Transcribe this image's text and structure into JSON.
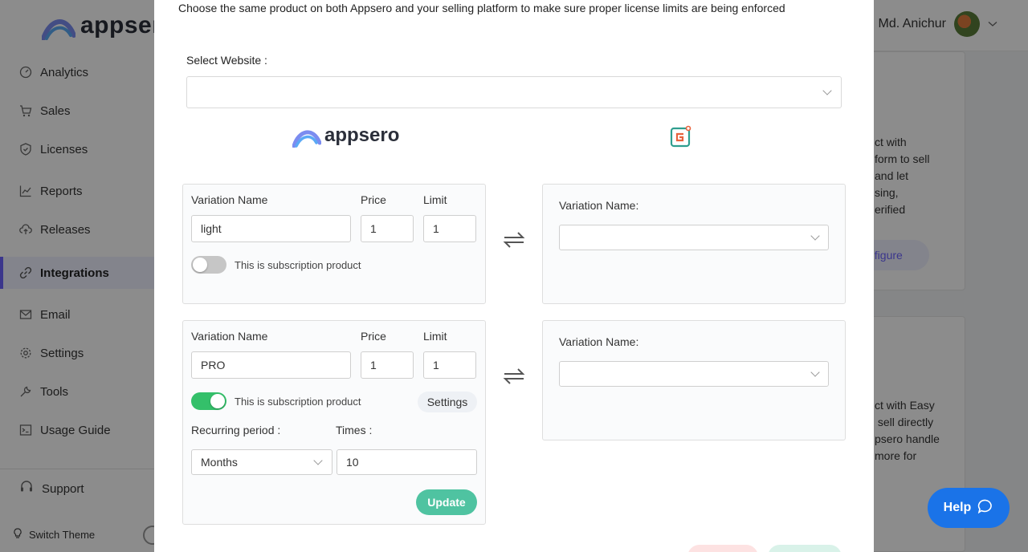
{
  "brand": {
    "name": "appsero"
  },
  "sidebar": {
    "items": [
      {
        "label": "Analytics",
        "icon": "gauge-icon"
      },
      {
        "label": "Sales",
        "icon": "cart-icon"
      },
      {
        "label": "Licenses",
        "icon": "shield-icon"
      },
      {
        "label": "Reports",
        "icon": "chart-icon"
      },
      {
        "label": "Releases",
        "icon": "cloud-upload-icon"
      },
      {
        "label": "Integrations",
        "icon": "link-icon",
        "active": true
      },
      {
        "label": "Email",
        "icon": "envelope-icon"
      },
      {
        "label": "Settings",
        "icon": "gear-icon"
      },
      {
        "label": "Tools",
        "icon": "wrench-icon"
      },
      {
        "label": "Usage Guide",
        "icon": "terminal-icon"
      }
    ],
    "support_label": "Support",
    "switch_theme_label": "Switch Theme"
  },
  "header": {
    "user_name": "Md. Anichur"
  },
  "cards": {
    "card1_text": "ct with\nform to sell\nand let\nsing,\nerified",
    "card1_button": "nfigure",
    "card2_text": "ct with Easy\n sell directly\npsero handle\nmore for"
  },
  "modal": {
    "intro": "Choose the same product on both Appsero and your selling platform to make sure proper license limits are being enforced",
    "select_website_label": "Select Website :",
    "select_website_value": "",
    "variation_name_label": "Variation Name",
    "price_label": "Price",
    "limit_label": "Limit",
    "subscription_label": "This is subscription product",
    "platform_variation_label": "Variation Name:",
    "variations": [
      {
        "name": "light",
        "price": "1",
        "limit": "1",
        "subscription": false
      },
      {
        "name": "PRO",
        "price": "1",
        "limit": "1",
        "subscription": true
      }
    ],
    "settings_label": "Settings",
    "recurring_period_label": "Recurring period :",
    "recurring_period_value": "Months",
    "times_label": "Times :",
    "times_value": "10",
    "update_label": "Update"
  },
  "help": {
    "label": "Help"
  },
  "colors": {
    "accent": "#6c63ff",
    "toggle_on": "#34c06a",
    "update_button": "#4fc3a1",
    "help_button": "#1a73e8"
  }
}
